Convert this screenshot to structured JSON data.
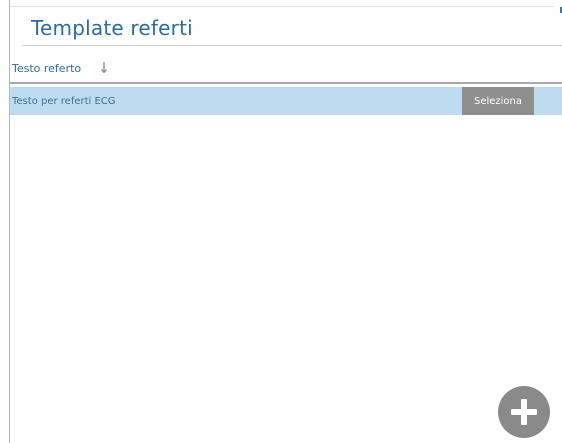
{
  "header": {
    "title": "Template referti"
  },
  "table": {
    "columns": [
      {
        "label": "Testo referto",
        "sort_icon": "sort-descending-icon"
      }
    ],
    "rows": [
      {
        "text": "Testo per referti ECG",
        "action_label": "Seleziona",
        "selected": true
      }
    ]
  },
  "fab": {
    "icon": "plus-icon"
  },
  "colors": {
    "title": "#2f6c9c",
    "row_selected_bg": "#bedcf0",
    "button_bg": "#8f8f8f",
    "fab_bg": "#8a8a8a"
  }
}
